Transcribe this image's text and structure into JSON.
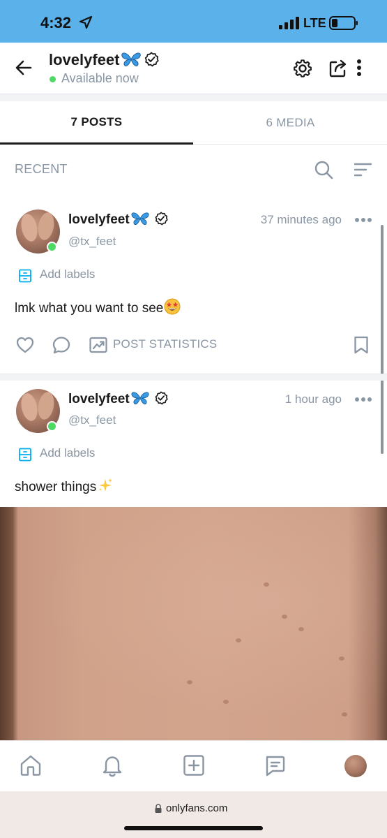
{
  "status_bar": {
    "time": "4:32",
    "network": "LTE"
  },
  "header": {
    "name": "lovelyfeet",
    "status": "Available now"
  },
  "tabs": [
    {
      "label": "7 POSTS",
      "active": true
    },
    {
      "label": "6 MEDIA",
      "active": false
    }
  ],
  "filter": {
    "label": "RECENT"
  },
  "posts": [
    {
      "name": "lovelyfeet",
      "handle": "@tx_feet",
      "time": "37 minutes ago",
      "labels": "Add labels",
      "text": "lmk what you want to see",
      "stats_label": "POST STATISTICS"
    },
    {
      "name": "lovelyfeet",
      "handle": "@tx_feet",
      "time": "1 hour ago",
      "labels": "Add labels",
      "text": "shower things"
    }
  ],
  "browser": {
    "url": "onlyfans.com"
  },
  "colors": {
    "status_bar": "#5bb1ea",
    "accent": "#00aff0",
    "muted": "#8a96a3",
    "online": "#4cd964"
  }
}
